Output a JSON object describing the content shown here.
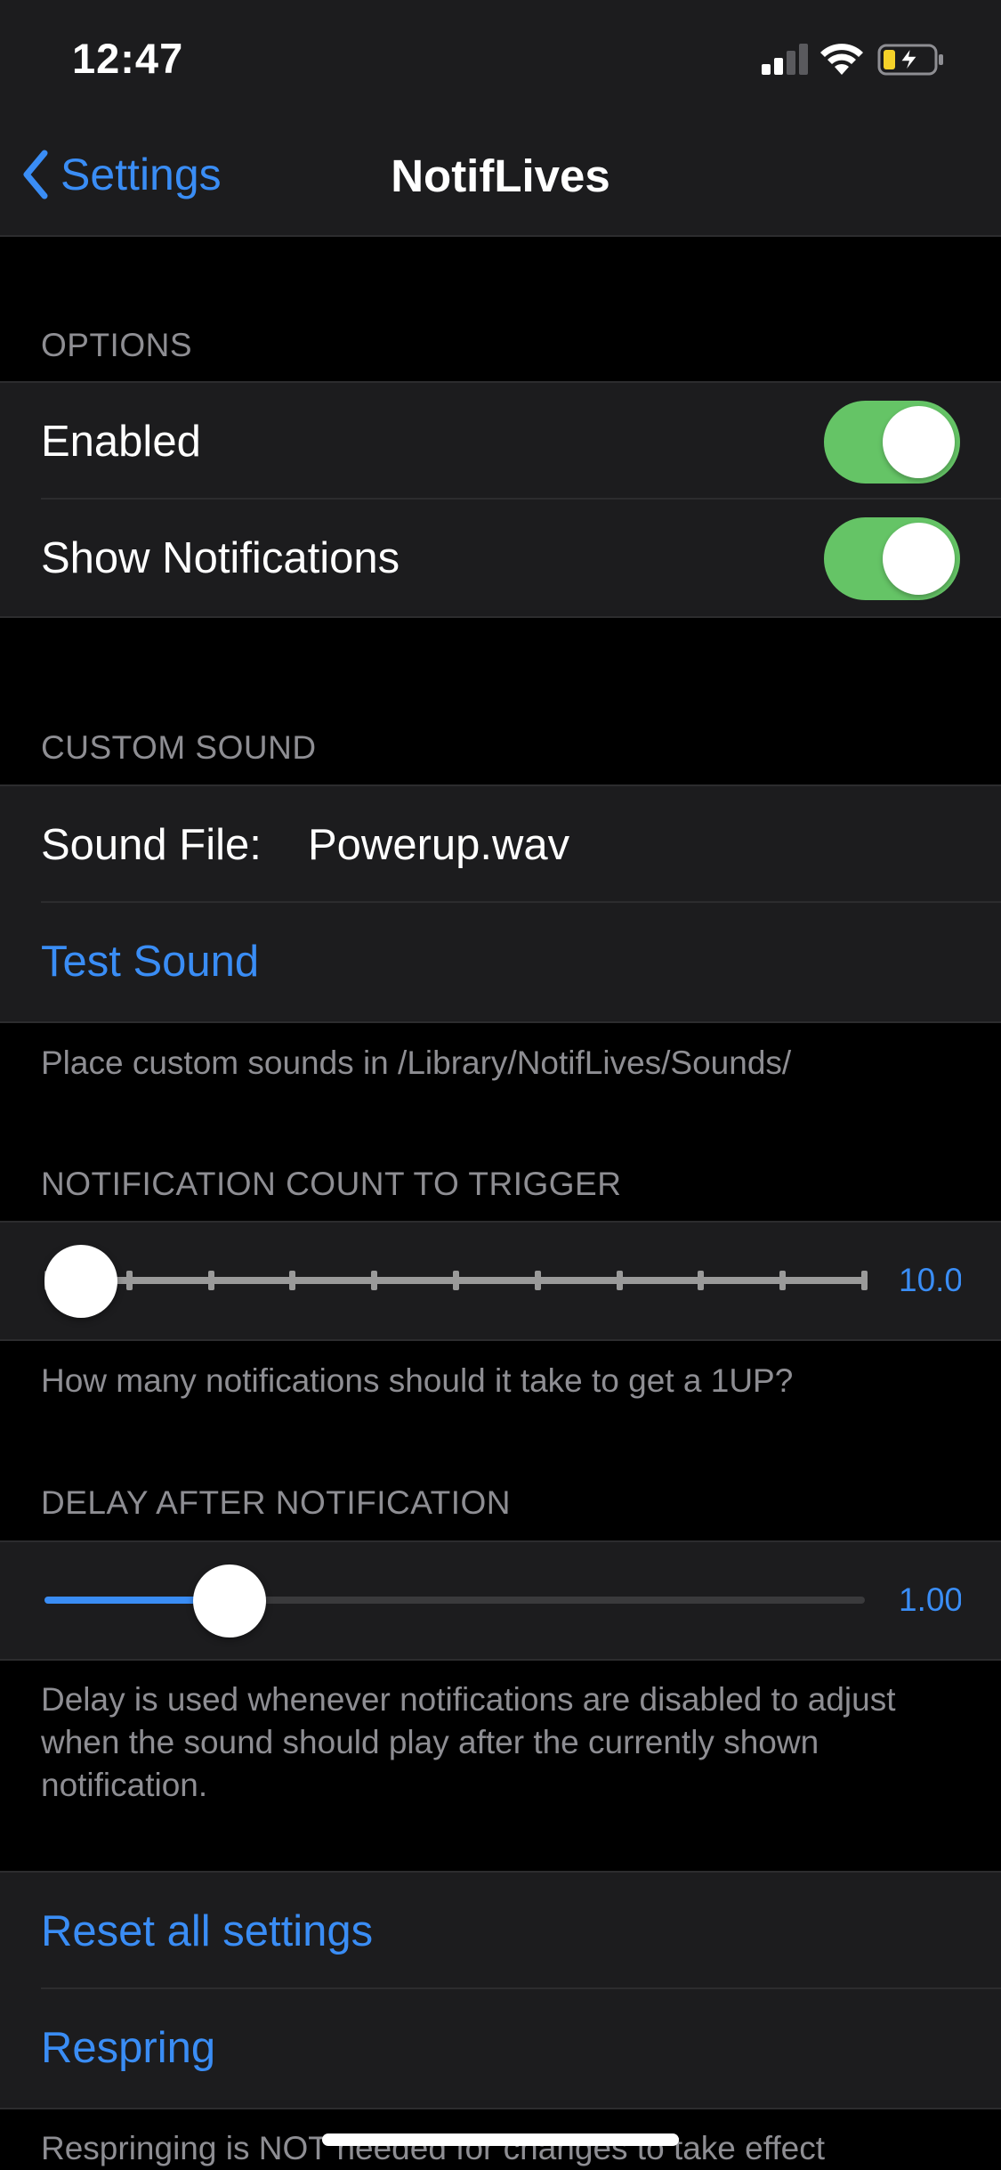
{
  "status_bar": {
    "time": "12:47",
    "icons": [
      "cellular-signal-icon",
      "wifi-icon",
      "battery-charging-icon"
    ]
  },
  "nav": {
    "back_label": "Settings",
    "title": "NotifLives"
  },
  "options": {
    "header": "OPTIONS",
    "enabled_label": "Enabled",
    "enabled_on": true,
    "show_notifications_label": "Show Notifications",
    "show_notifications_on": true
  },
  "custom_sound": {
    "header": "CUSTOM SOUND",
    "sound_file_label": "Sound File:",
    "sound_file_value": "Powerup.wav",
    "test_sound_label": "Test Sound",
    "footer": "Place custom sounds in /Library/NotifLives/Sounds/"
  },
  "notification_count": {
    "header": "NOTIFICATION COUNT TO TRIGGER",
    "value_text": "10.0",
    "footer": "How many notifications should it take to get a 1UP?"
  },
  "delay": {
    "header": "DELAY AFTER NOTIFICATION",
    "value_text": "1.00",
    "footer": "Delay is used whenever notifications are disabled to adjust when the sound should play after the currently shown notification."
  },
  "actions": {
    "reset_label": "Reset all settings",
    "respring_label": "Respring",
    "footer": "Respringing is NOT needed for changes to take effect"
  },
  "colors": {
    "accent": "#3a8df5",
    "toggle_on": "#65c466",
    "cell_background": "#1c1c1e",
    "background": "#000000",
    "secondary_text": "#8e8e93"
  }
}
